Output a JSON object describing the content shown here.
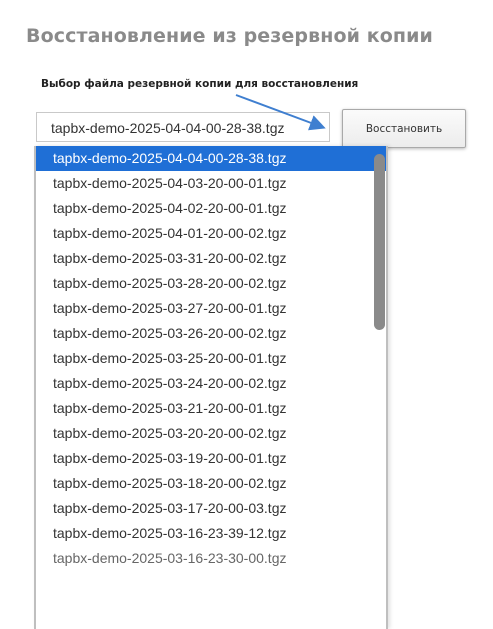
{
  "page": {
    "title": "Восстановление из резервной копии",
    "subtitle": "Выбор файла резервной копии для восстановления"
  },
  "backup_select": {
    "selected_value": "tapbx-demo-2025-04-04-00-28-38.tgz",
    "options": [
      "tapbx-demo-2025-04-04-00-28-38.tgz",
      "tapbx-demo-2025-04-03-20-00-01.tgz",
      "tapbx-demo-2025-04-02-20-00-01.tgz",
      "tapbx-demo-2025-04-01-20-00-02.tgz",
      "tapbx-demo-2025-03-31-20-00-02.tgz",
      "tapbx-demo-2025-03-28-20-00-02.tgz",
      "tapbx-demo-2025-03-27-20-00-01.tgz",
      "tapbx-demo-2025-03-26-20-00-02.tgz",
      "tapbx-demo-2025-03-25-20-00-01.tgz",
      "tapbx-demo-2025-03-24-20-00-02.tgz",
      "tapbx-demo-2025-03-21-20-00-01.tgz",
      "tapbx-demo-2025-03-20-20-00-02.tgz",
      "tapbx-demo-2025-03-19-20-00-01.tgz",
      "tapbx-demo-2025-03-18-20-00-02.tgz",
      "tapbx-demo-2025-03-17-20-00-03.tgz",
      "tapbx-demo-2025-03-16-23-39-12.tgz",
      "tapbx-demo-2025-03-16-23-30-00.tgz"
    ],
    "selected_index": 0
  },
  "restore_button": {
    "label": "Восстановить"
  },
  "annotation": {
    "arrow_color": "#3f7fd0"
  },
  "colors": {
    "title": "#8a8a8a",
    "selected_bg": "#1f6fd6",
    "scrollbar": "#8a8a8a"
  },
  "icons": {
    "annotation_arrow": "arrow-icon"
  }
}
